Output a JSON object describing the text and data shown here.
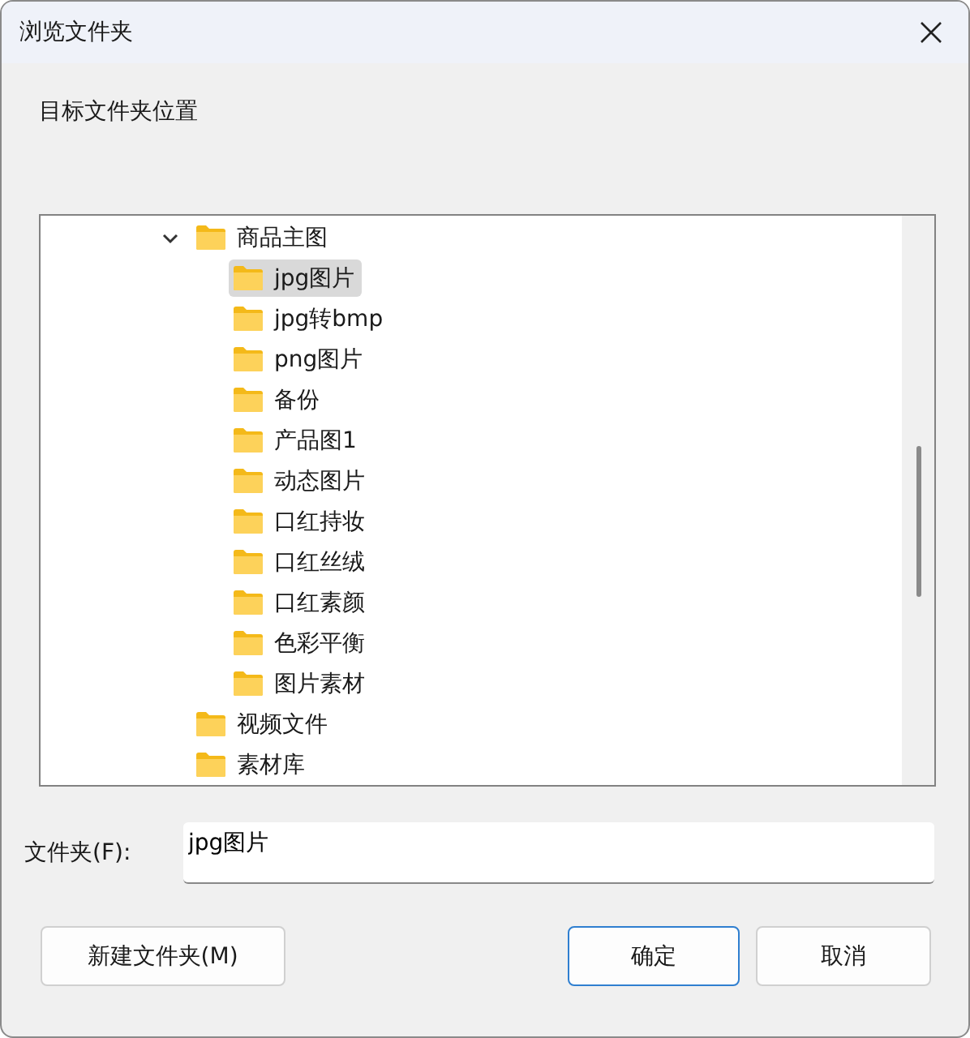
{
  "window": {
    "title": "浏览文件夹"
  },
  "description": "目标文件夹位置",
  "tree": [
    {
      "label": "商品主图",
      "expanded": true,
      "selected": false,
      "children": [
        {
          "label": "jpg图片",
          "selected": true
        },
        {
          "label": "jpg转bmp",
          "selected": false
        },
        {
          "label": "png图片",
          "selected": false
        },
        {
          "label": "备份",
          "selected": false
        },
        {
          "label": "产品图1",
          "selected": false
        },
        {
          "label": "动态图片",
          "selected": false
        },
        {
          "label": "口红持妆",
          "selected": false
        },
        {
          "label": "口红丝绒",
          "selected": false
        },
        {
          "label": "口红素颜",
          "selected": false
        },
        {
          "label": "色彩平衡",
          "selected": false
        },
        {
          "label": "图片素材",
          "selected": false
        }
      ]
    },
    {
      "label": "视频文件",
      "selected": false
    },
    {
      "label": "素材库",
      "selected": false
    }
  ],
  "folder_field": {
    "label": "文件夹(F):",
    "value": "jpg图片"
  },
  "buttons": [
    {
      "label": "新建文件夹(M)",
      "kind": "normal"
    },
    {
      "label": "确定",
      "kind": "default"
    },
    {
      "label": "取消",
      "kind": "normal"
    }
  ]
}
